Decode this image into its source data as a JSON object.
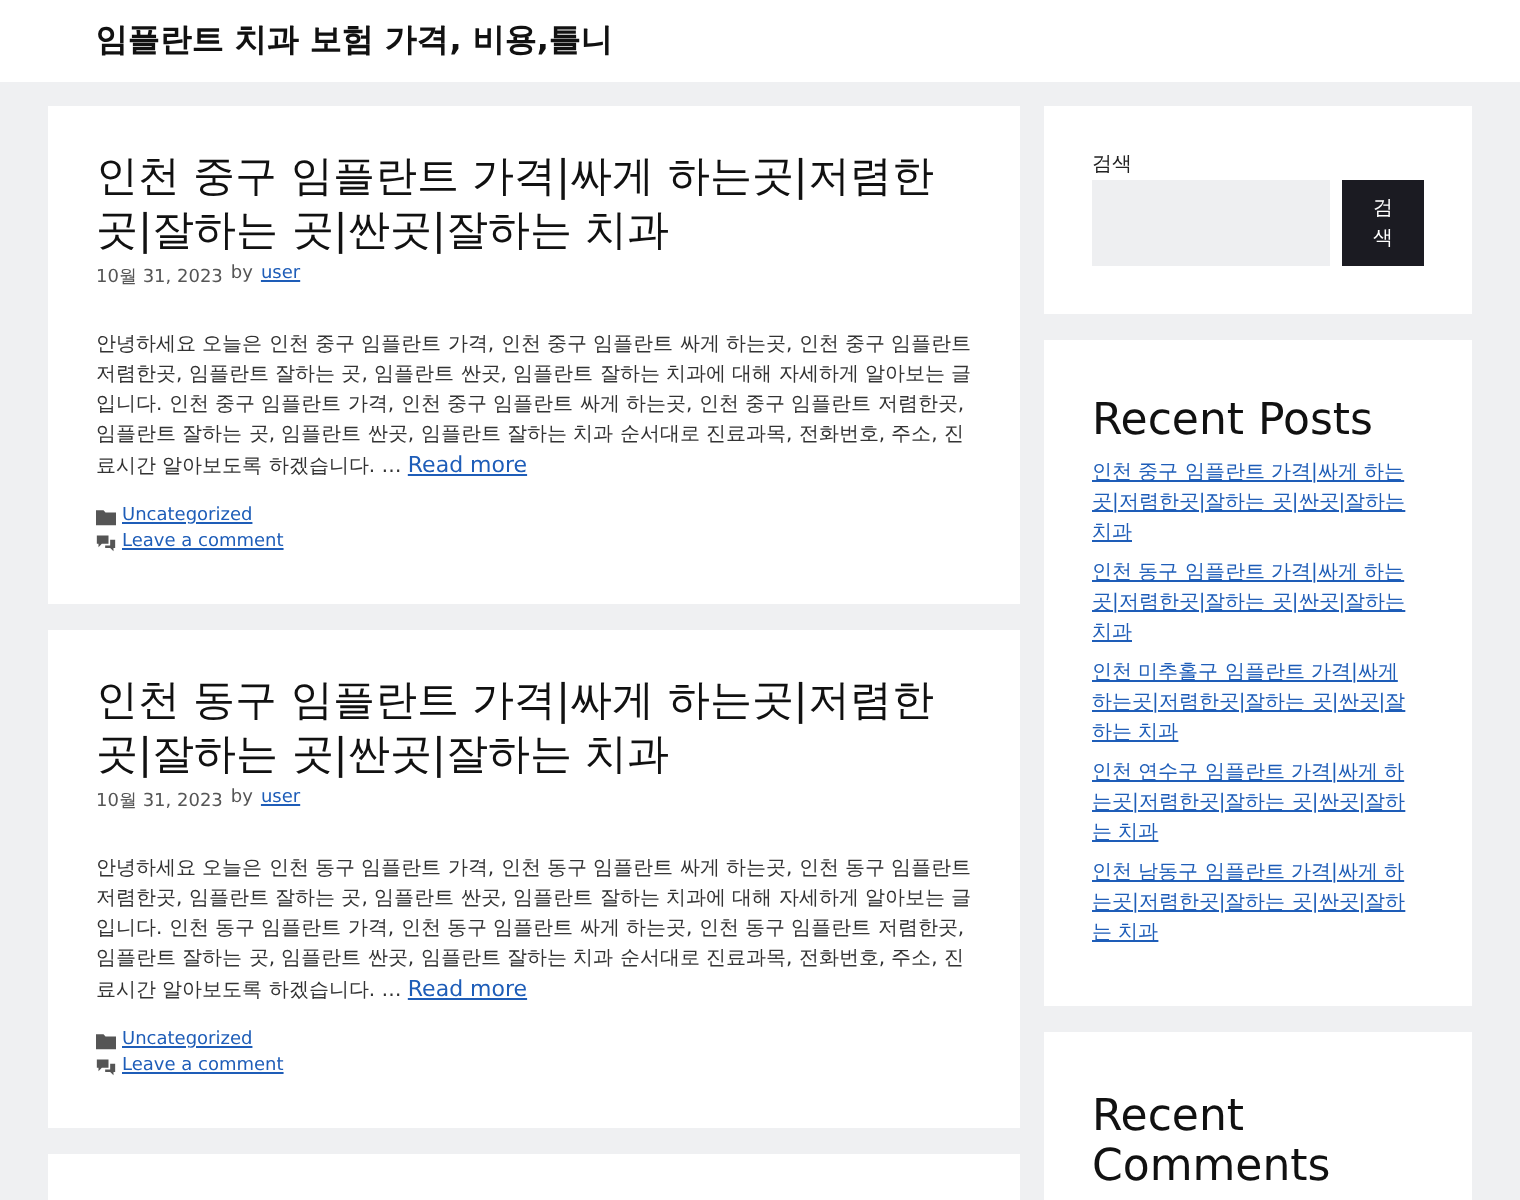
{
  "site_title": "임플란트 치과 보험 가격, 비용,틀니",
  "posts": [
    {
      "title": "인천 중구 임플란트 가격|싸게 하는곳|저렴한 곳|잘하는 곳|싼곳|잘하는 치과",
      "date": "10월 31, 2023",
      "by": "by",
      "author": "user",
      "excerpt": "안녕하세요 오늘은 인천 중구 임플란트 가격, 인천 중구 임플란트 싸게 하는곳, 인천 중구 임플란트 저렴한곳, 임플란트 잘하는 곳, 임플란트 싼곳, 임플란트 잘하는 치과에 대해 자세하게 알아보는 글입니다. 인천 중구 임플란트 가격, 인천 중구 임플란트 싸게 하는곳, 인천 중구 임플란트 저렴한곳, 임플란트 잘하는 곳, 임플란트 싼곳, 임플란트 잘하는 치과 순서대로 진료과목, 전화번호, 주소, 진료시간 알아보도록 하겠습니다. …",
      "read_more": "Read more",
      "category": "Uncategorized",
      "comment_link": "Leave a comment"
    },
    {
      "title": "인천 동구 임플란트 가격|싸게 하는곳|저렴한 곳|잘하는 곳|싼곳|잘하는 치과",
      "date": "10월 31, 2023",
      "by": "by",
      "author": "user",
      "excerpt": "안녕하세요 오늘은 인천 동구 임플란트 가격, 인천 동구 임플란트 싸게 하는곳, 인천 동구 임플란트 저렴한곳, 임플란트 잘하는 곳, 임플란트 싼곳, 임플란트 잘하는 치과에 대해 자세하게 알아보는 글입니다. 인천 동구 임플란트 가격, 인천 동구 임플란트 싸게 하는곳, 인천 동구 임플란트 저렴한곳, 임플란트 잘하는 곳, 임플란트 싼곳, 임플란트 잘하는 치과 순서대로 진료과목, 전화번호, 주소, 진료시간 알아보도록 하겠습니다. …",
      "read_more": "Read more",
      "category": "Uncategorized",
      "comment_link": "Leave a comment"
    }
  ],
  "sidebar": {
    "search": {
      "label": "검색",
      "button": "검색"
    },
    "recent_posts": {
      "heading": "Recent Posts",
      "items": [
        "인천 중구 임플란트 가격|싸게 하는곳|저렴한곳|잘하는 곳|싼곳|잘하는 치과",
        "인천 동구 임플란트 가격|싸게 하는곳|저렴한곳|잘하는 곳|싼곳|잘하는 치과",
        "인천 미추홀구 임플란트 가격|싸게 하는곳|저렴한곳|잘하는 곳|싼곳|잘하는 치과",
        "인천 연수구 임플란트 가격|싸게 하는곳|저렴한곳|잘하는 곳|싼곳|잘하는 치과",
        "인천 남동구 임플란트 가격|싸게 하는곳|저렴한곳|잘하는 곳|싼곳|잘하는 치과"
      ]
    },
    "recent_comments": {
      "heading": "Recent Comments"
    }
  }
}
